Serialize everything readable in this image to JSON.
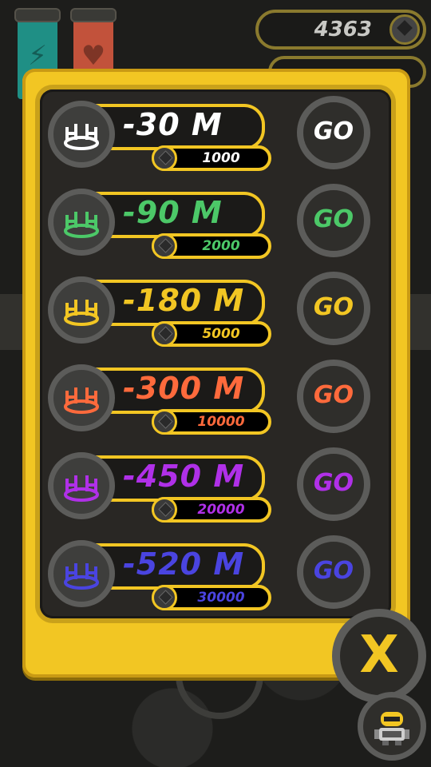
{
  "hud": {
    "gem_count": "4363",
    "energy_icon": "lightning-icon",
    "health_icon": "heart-icon",
    "gem_icon": "gem-icon"
  },
  "colors": {
    "dialog_frame": "#f2c623",
    "panel_bg": "#292724"
  },
  "options": [
    {
      "amount": "-30 M",
      "cost": "1000",
      "go": "GO",
      "color": "#ffffff"
    },
    {
      "amount": "-90 M",
      "cost": "2000",
      "go": "GO",
      "color": "#4cc868"
    },
    {
      "amount": "-180 M",
      "cost": "5000",
      "go": "GO",
      "color": "#f2c623"
    },
    {
      "amount": "-300 M",
      "cost": "10000",
      "go": "GO",
      "color": "#ff6a3c"
    },
    {
      "amount": "-450 M",
      "cost": "20000",
      "go": "GO",
      "color": "#b030e8"
    },
    {
      "amount": "-520 M",
      "cost": "30000",
      "go": "GO",
      "color": "#4a44e0"
    }
  ],
  "close_label": "X",
  "avatar_icon": "robot-avatar-icon"
}
